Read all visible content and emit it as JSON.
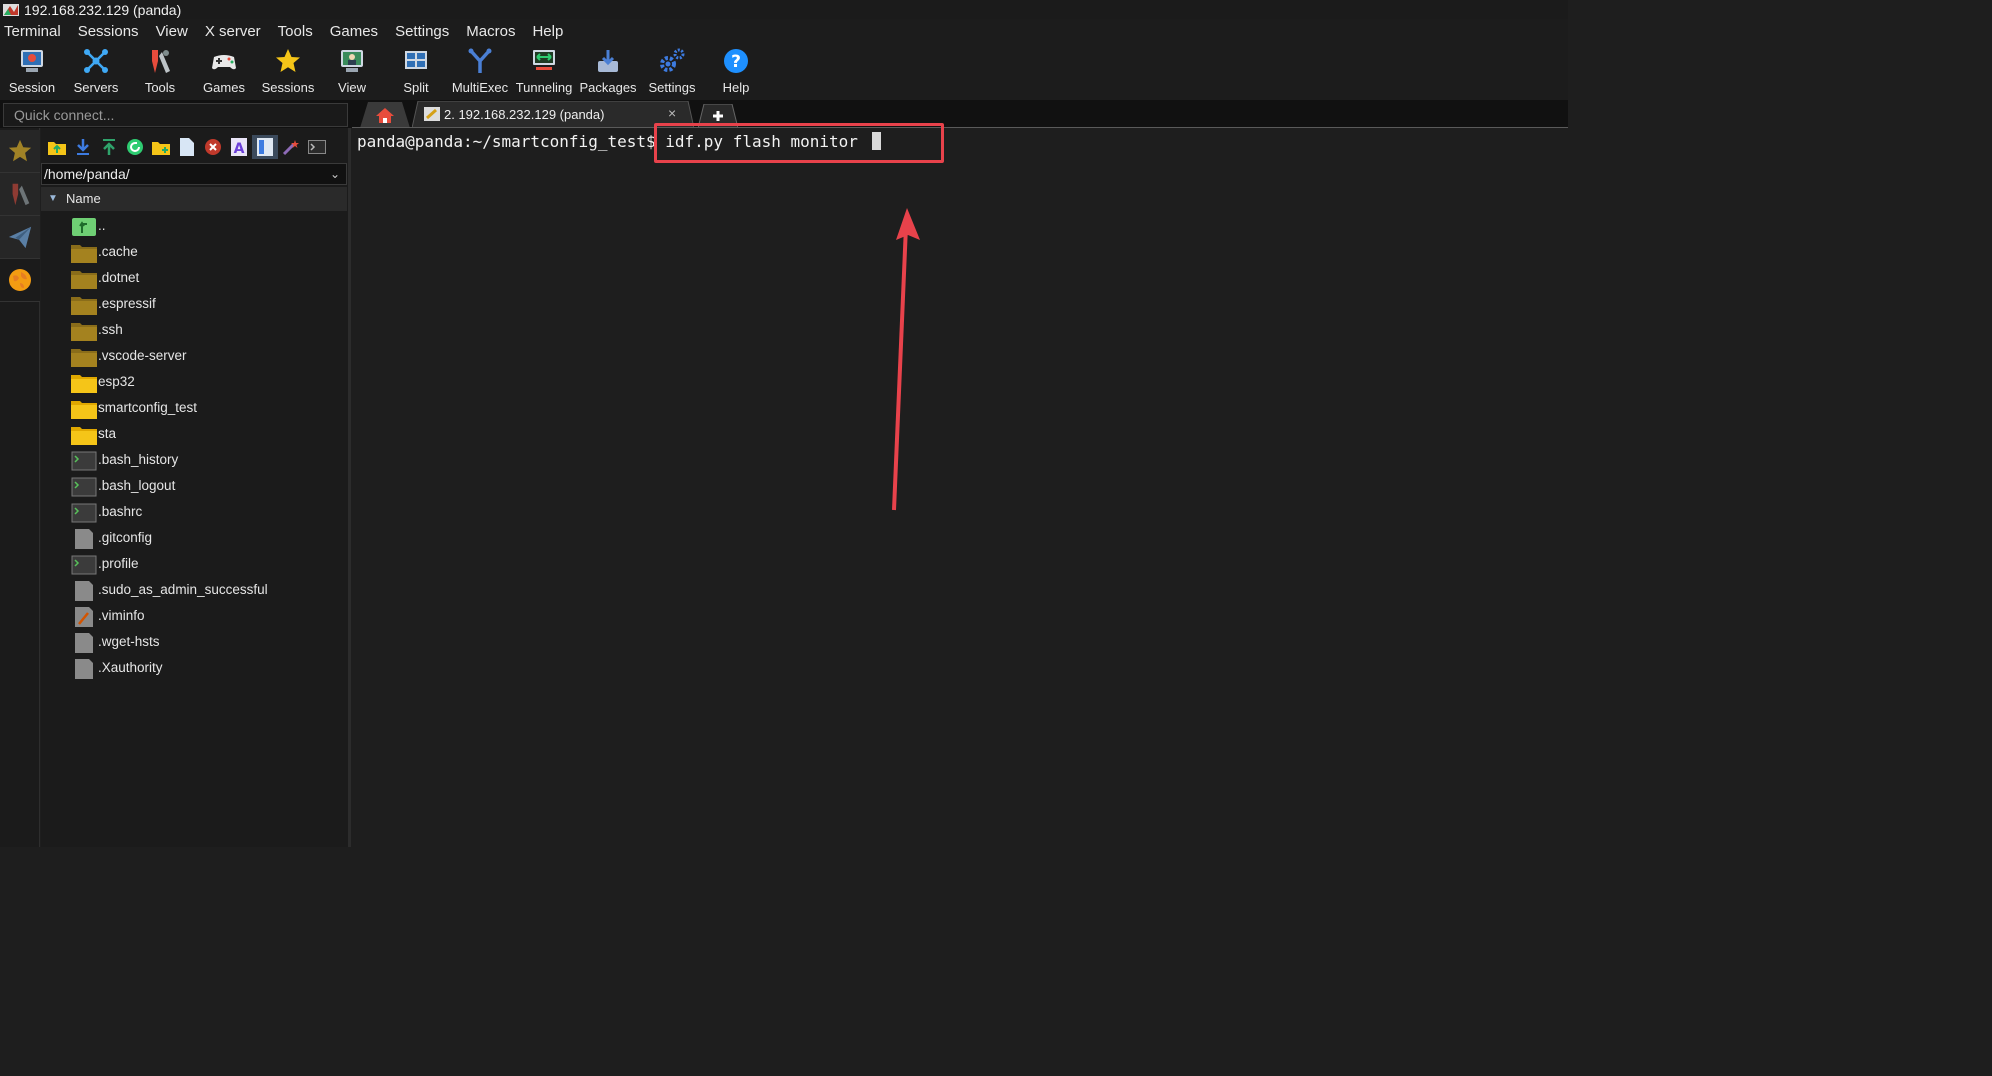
{
  "window": {
    "title": "192.168.232.129 (panda)"
  },
  "menu": [
    "Terminal",
    "Sessions",
    "View",
    "X server",
    "Tools",
    "Games",
    "Settings",
    "Macros",
    "Help"
  ],
  "toolbar": [
    {
      "label": "Session",
      "icon": "session-icon"
    },
    {
      "label": "Servers",
      "icon": "servers-icon"
    },
    {
      "label": "Tools",
      "icon": "tools-icon"
    },
    {
      "label": "Games",
      "icon": "gamepad-icon"
    },
    {
      "label": "Sessions",
      "icon": "star-icon"
    },
    {
      "label": "View",
      "icon": "view-icon"
    },
    {
      "label": "Split",
      "icon": "split-icon"
    },
    {
      "label": "MultiExec",
      "icon": "multiexec-icon"
    },
    {
      "label": "Tunneling",
      "icon": "tunneling-icon"
    },
    {
      "label": "Packages",
      "icon": "packages-icon"
    },
    {
      "label": "Settings",
      "icon": "gears-icon"
    },
    {
      "label": "Help",
      "icon": "help-icon"
    }
  ],
  "quick_connect": {
    "placeholder": "Quick connect..."
  },
  "tabs": {
    "session_label": "2. 192.168.232.129 (panda)",
    "close": "×"
  },
  "file_browser": {
    "path": "/home/panda/",
    "column": "Name",
    "items": [
      {
        "name": "..",
        "type": "up"
      },
      {
        "name": ".cache",
        "type": "folder-dark"
      },
      {
        "name": ".dotnet",
        "type": "folder-dark"
      },
      {
        "name": ".espressif",
        "type": "folder-dark"
      },
      {
        "name": ".ssh",
        "type": "folder-dark"
      },
      {
        "name": ".vscode-server",
        "type": "folder-dark"
      },
      {
        "name": "esp32",
        "type": "folder"
      },
      {
        "name": "smartconfig_test",
        "type": "folder"
      },
      {
        "name": "sta",
        "type": "folder"
      },
      {
        "name": ".bash_history",
        "type": "shell"
      },
      {
        "name": ".bash_logout",
        "type": "shell"
      },
      {
        "name": ".bashrc",
        "type": "shell"
      },
      {
        "name": ".gitconfig",
        "type": "file"
      },
      {
        "name": ".profile",
        "type": "shell"
      },
      {
        "name": ".sudo_as_admin_successful",
        "type": "file"
      },
      {
        "name": ".viminfo",
        "type": "file-edit"
      },
      {
        "name": ".wget-hsts",
        "type": "file"
      },
      {
        "name": ".Xauthority",
        "type": "file"
      }
    ]
  },
  "terminal": {
    "prompt": "panda@panda:~/smartconfig_test$",
    "command": "idf.py flash monitor"
  },
  "colors": {
    "annotation": "#e8424b",
    "folder": "#f5c518",
    "folder_dark": "#8a6d1a"
  }
}
